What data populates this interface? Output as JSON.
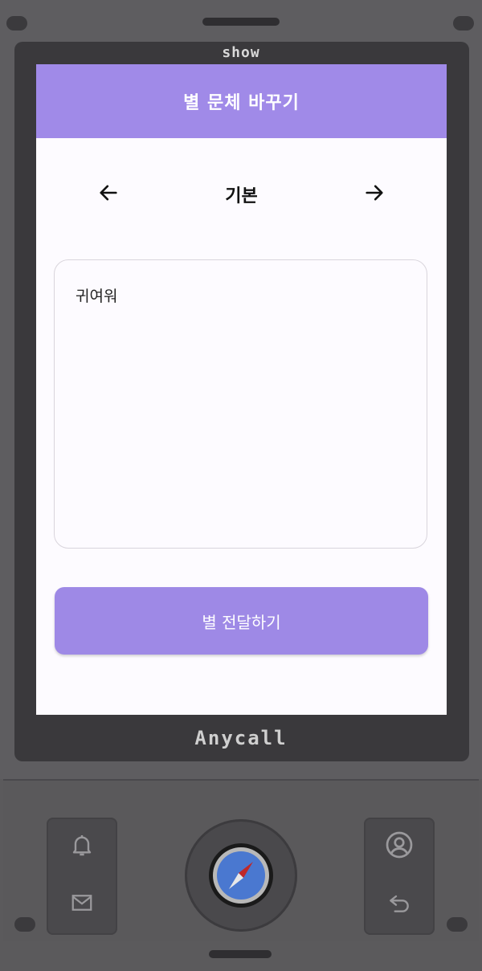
{
  "device": {
    "top_brand": "show",
    "bottom_brand": "Anycall"
  },
  "header": {
    "title": "별 문체 바꾸기"
  },
  "font_switch": {
    "current_font": "기본",
    "prev_icon": "arrow-left-icon",
    "next_icon": "arrow-right-icon"
  },
  "message": {
    "text": "귀여워"
  },
  "send_button": {
    "label": "별 전달하기"
  },
  "keypad": {
    "left_top_icon": "bell-icon",
    "left_bottom_icon": "mail-icon",
    "center_icon": "compass-icon",
    "right_top_icon": "profile-icon",
    "right_bottom_icon": "back-icon"
  },
  "colors": {
    "accent": "#a08ae8",
    "button": "#9e89e6",
    "screen_bg": "#fdfbff",
    "body": "#5b5a5c"
  }
}
